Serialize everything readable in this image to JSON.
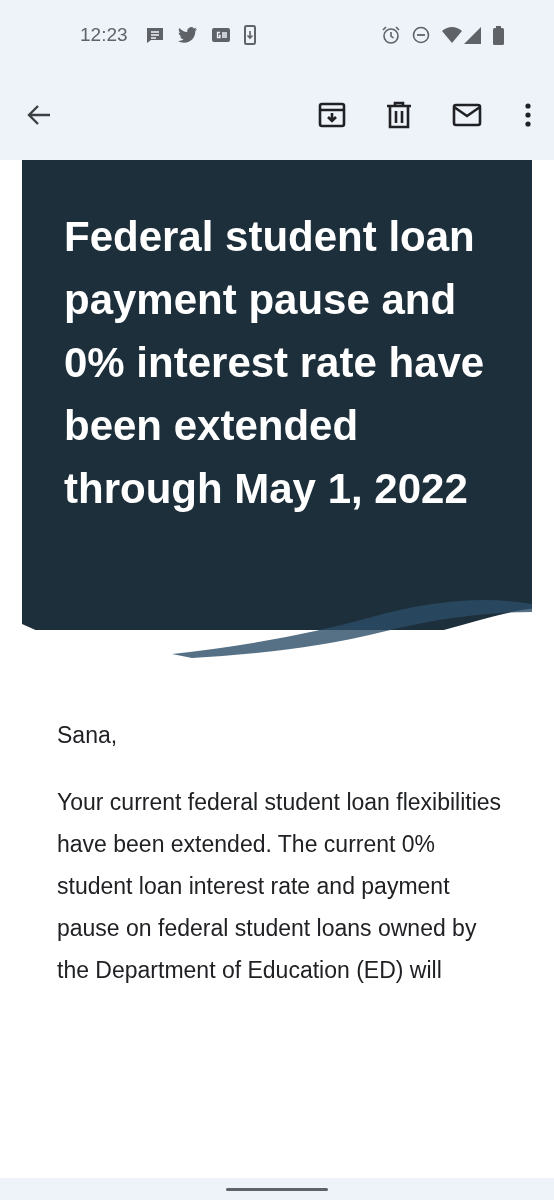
{
  "status_bar": {
    "time": "12:23"
  },
  "email": {
    "headline": "Federal student loan payment pause and 0% interest rate have been extended through May 1, 2022",
    "greeting": "Sana,",
    "paragraph": "Your current federal student loan flexibilities have been extended. The current 0% student loan interest rate and payment pause on federal student loans owned by the Department of Education (ED) will"
  }
}
